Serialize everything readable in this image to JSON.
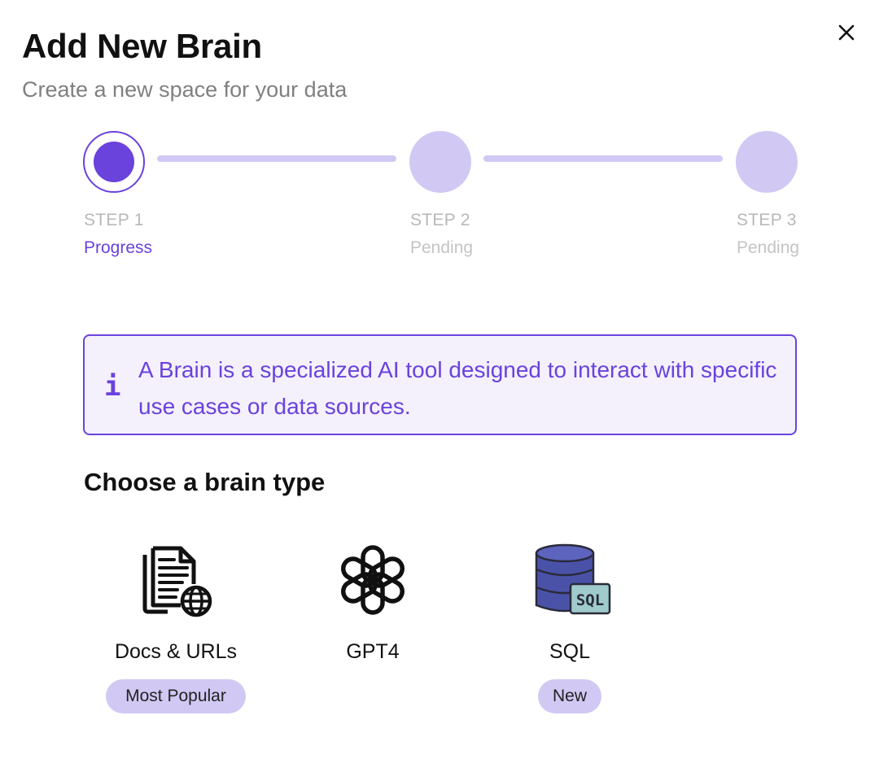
{
  "modal": {
    "title": "Add New Brain",
    "subtitle": "Create a new space for your data",
    "close_icon": "close-icon"
  },
  "stepper": {
    "steps": [
      {
        "label": "STEP 1",
        "status": "Progress",
        "state": "active"
      },
      {
        "label": "STEP 2",
        "status": "Pending",
        "state": "pending"
      },
      {
        "label": "STEP 3",
        "status": "Pending",
        "state": "pending"
      }
    ]
  },
  "info": {
    "icon": "info-icon",
    "text": "A Brain is a specialized AI tool designed to interact with specific use cases or data sources."
  },
  "brain_types": {
    "heading": "Choose a brain type",
    "items": [
      {
        "name": "Docs & URLs",
        "icon": "document-globe-icon",
        "badge": "Most Popular"
      },
      {
        "name": "GPT4",
        "icon": "openai-icon",
        "badge": ""
      },
      {
        "name": "SQL",
        "icon": "sql-database-icon",
        "badge": "New"
      }
    ]
  },
  "colors": {
    "accent": "#6a42dc",
    "accent_light": "#d1c9f3",
    "info_bg": "#f4f1fd",
    "muted_text": "#808080"
  }
}
